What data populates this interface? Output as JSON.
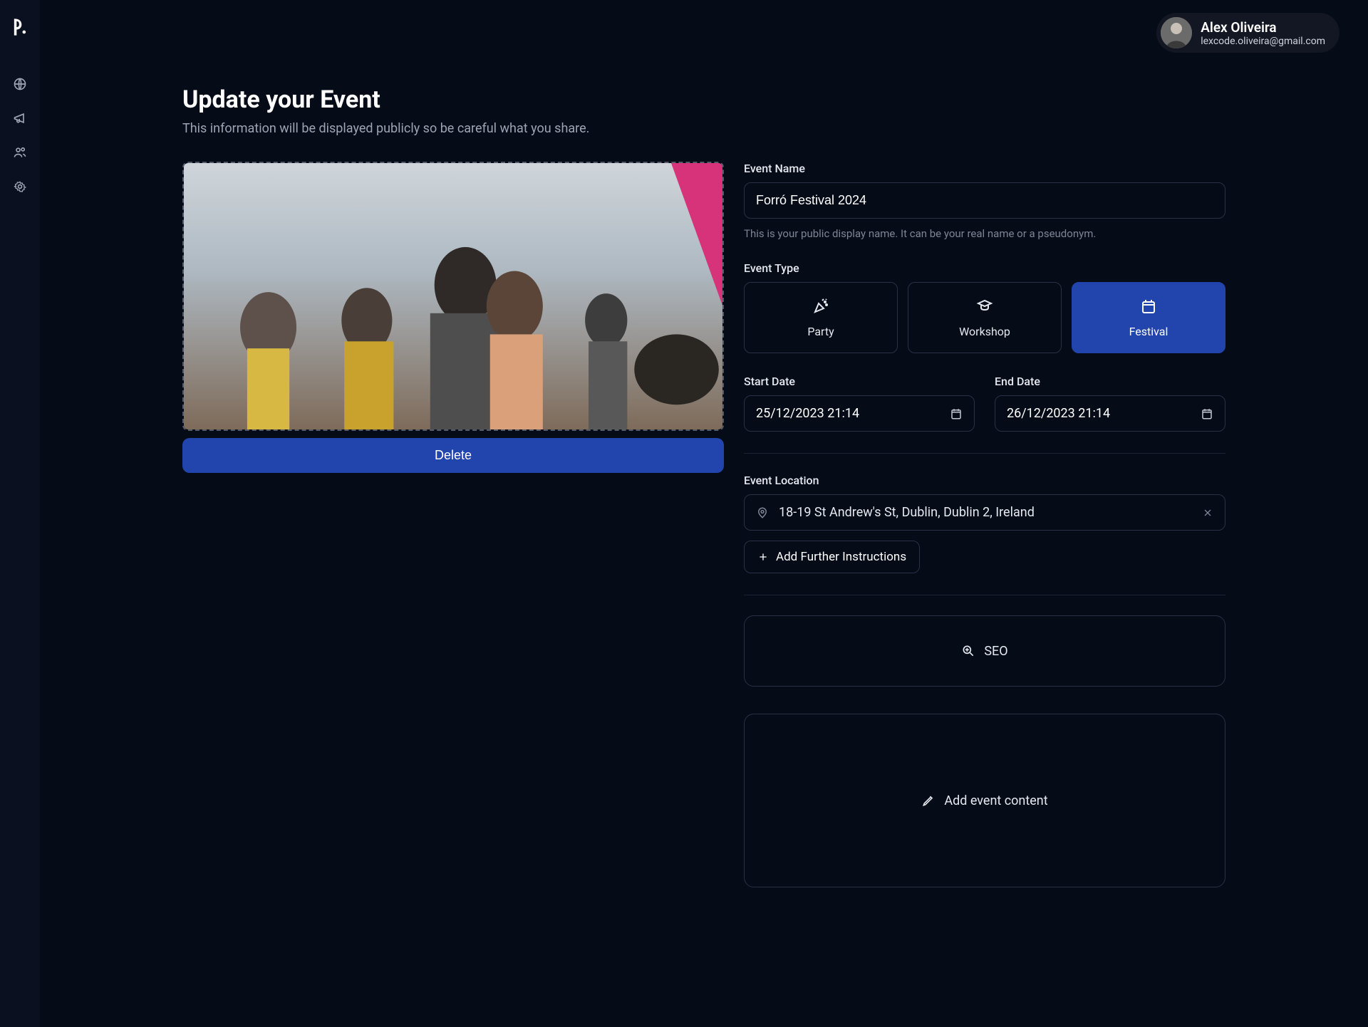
{
  "user": {
    "name": "Alex Oliveira",
    "email": "lexcode.oliveira@gmail.com"
  },
  "page": {
    "title": "Update your Event",
    "subtitle": "This information will be displayed publicly so be careful what you share."
  },
  "nav": {
    "icons": [
      "globe",
      "megaphone",
      "users",
      "settings"
    ]
  },
  "image": {
    "delete_label": "Delete"
  },
  "event_name": {
    "label": "Event Name",
    "value": "Forró Festival 2024",
    "hint": "This is your public display name. It can be your real name or a pseudonym."
  },
  "event_type": {
    "label": "Event Type",
    "options": [
      {
        "label": "Party",
        "icon": "party",
        "selected": false
      },
      {
        "label": "Workshop",
        "icon": "workshop",
        "selected": false
      },
      {
        "label": "Festival",
        "icon": "festival",
        "selected": true
      }
    ]
  },
  "dates": {
    "start_label": "Start Date",
    "start_value": "25/12/2023 21:14",
    "end_label": "End Date",
    "end_value": "26/12/2023 21:14"
  },
  "location": {
    "label": "Event Location",
    "value": "18-19 St Andrew's St, Dublin, Dublin 2, Ireland",
    "add_instructions_label": "Add Further Instructions"
  },
  "seo": {
    "label": "SEO"
  },
  "event_content": {
    "label": "Add event content"
  },
  "colors": {
    "accent": "#2244ad",
    "bg": "#060b18",
    "border": "#2a3142"
  }
}
